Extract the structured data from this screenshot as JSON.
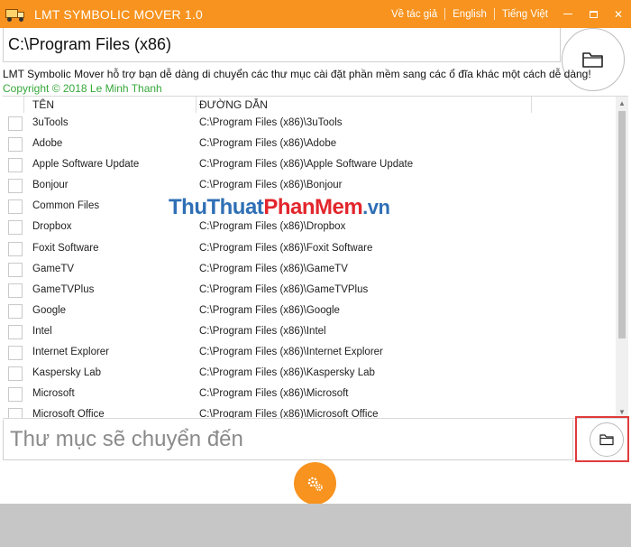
{
  "window": {
    "title": "LMT SYMBOLIC MOVER 1.0",
    "links": [
      "Về tác giả",
      "English",
      "Tiếng Việt"
    ],
    "min_glyph": "",
    "close_glyph": "✕"
  },
  "source": {
    "path_value": "C:\\Program Files (x86)"
  },
  "description": "LMT Symbolic Mover hỗ trợ bạn dễ dàng di chuyển các thư mục cài đặt phần mềm sang các ổ đĩa khác một cách dễ dàng!",
  "copyright": "Copyright © 2018 Le Minh Thanh",
  "table": {
    "col_name": "TÊN",
    "col_path": "ĐƯỜNG DẪN",
    "rows": [
      {
        "name": "3uTools",
        "path": "C:\\Program Files (x86)\\3uTools"
      },
      {
        "name": "Adobe",
        "path": "C:\\Program Files (x86)\\Adobe"
      },
      {
        "name": "Apple Software Update",
        "path": "C:\\Program Files (x86)\\Apple Software Update"
      },
      {
        "name": "Bonjour",
        "path": "C:\\Program Files (x86)\\Bonjour"
      },
      {
        "name": "Common Files",
        "path": ""
      },
      {
        "name": "Dropbox",
        "path": "C:\\Program Files (x86)\\Dropbox"
      },
      {
        "name": "Foxit Software",
        "path": "C:\\Program Files (x86)\\Foxit Software"
      },
      {
        "name": "GameTV",
        "path": "C:\\Program Files (x86)\\GameTV"
      },
      {
        "name": "GameTVPlus",
        "path": "C:\\Program Files (x86)\\GameTVPlus"
      },
      {
        "name": "Google",
        "path": "C:\\Program Files (x86)\\Google"
      },
      {
        "name": "Intel",
        "path": "C:\\Program Files (x86)\\Intel"
      },
      {
        "name": "Internet Explorer",
        "path": "C:\\Program Files (x86)\\Internet Explorer"
      },
      {
        "name": "Kaspersky Lab",
        "path": "C:\\Program Files (x86)\\Kaspersky Lab"
      },
      {
        "name": "Microsoft",
        "path": "C:\\Program Files (x86)\\Microsoft"
      },
      {
        "name": "Microsoft Office",
        "path": "C:\\Program Files (x86)\\Microsoft Office"
      }
    ]
  },
  "watermark": {
    "part1": "ThuThuat",
    "part2": "PhanMem",
    "part3": ".vn"
  },
  "destination": {
    "placeholder": "Thư mục sẽ chuyển đến"
  },
  "icons": {
    "app": "truck-icon",
    "browse": "folder-icon",
    "move": "gears-icon"
  },
  "colors": {
    "accent": "#f7931e",
    "copyright_green": "#35a83a",
    "highlight_red": "#e03b3b",
    "footer_gray": "#c6c6c6"
  }
}
